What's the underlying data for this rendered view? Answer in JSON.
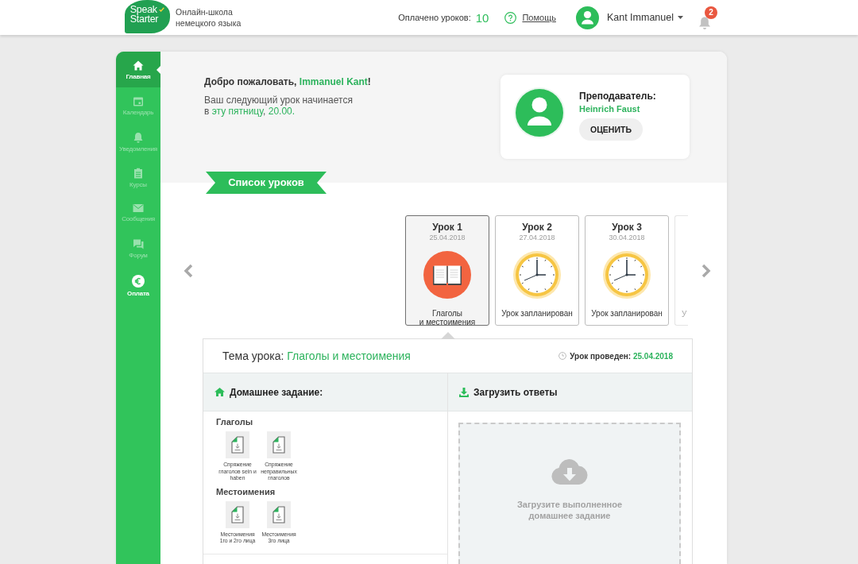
{
  "header": {
    "logo": "Speak Starter",
    "tagline": "Онлайн-школа\nнемецкого языка",
    "paid_label": "Оплачено уроков:",
    "paid_count": "10",
    "help": "Помощь",
    "user": "Kant Immanuel",
    "notifications": "2"
  },
  "sidebar": {
    "items": [
      {
        "label": "Главная",
        "selected": true,
        "disabled": false
      },
      {
        "label": "Календарь",
        "selected": false,
        "disabled": true
      },
      {
        "label": "Уведомления",
        "selected": false,
        "disabled": true
      },
      {
        "label": "Курсы",
        "selected": false,
        "disabled": true
      },
      {
        "label": "Сообщения",
        "selected": false,
        "disabled": true
      },
      {
        "label": "Форум",
        "selected": false,
        "disabled": true
      },
      {
        "label": "Оплата",
        "selected": false,
        "disabled": false
      }
    ]
  },
  "welcome": {
    "segments": [
      {
        "text": "Добро пожаловать, ",
        "kind": "plain"
      },
      {
        "text": "Immanuel Kant",
        "kind": "accent"
      },
      {
        "text": "!",
        "kind": "plain"
      }
    ]
  },
  "next_lesson": {
    "segments": [
      {
        "text": "Ваш следующий урок начинается\nв ",
        "kind": "plain"
      },
      {
        "text": "эту пятницу",
        "kind": "accent"
      },
      {
        "text": ", ",
        "kind": "plain"
      },
      {
        "text": "20.00.",
        "kind": "accent"
      }
    ]
  },
  "teacher": {
    "label": "Преподаватель:",
    "name": "Heinrich Faust",
    "rate_button": "ОЦЕНИТЬ"
  },
  "lessons": {
    "title": "Список уроков",
    "items": [
      {
        "title": "Урок 1",
        "date": "25.04.2018",
        "kind": "completed",
        "caption": "Глаголы\nи местоимения",
        "selected": true
      },
      {
        "title": "Урок 2",
        "date": "27.04.2018",
        "kind": "scheduled",
        "caption": "Урок запланирован",
        "selected": false
      },
      {
        "title": "Урок 3",
        "date": "30.04.2018",
        "kind": "scheduled",
        "caption": "Урок запланирован",
        "selected": false
      }
    ],
    "peek_caption": "У"
  },
  "lesson_details": {
    "topic_label": "Тема урока:",
    "topic": "Глаголы и местоимения",
    "held_label": "Урок проведен:",
    "held_date": "25.04.2018",
    "homework": {
      "title": "Домашнее задание:",
      "groups": [
        {
          "title": "Глаголы",
          "files": [
            "Спряжение\nглаголов sein и\nhaben",
            "Спряжение\nнеправильных\nглаголов"
          ]
        },
        {
          "title": "Местоимения",
          "files": [
            "Местоимения\n1го и 2го лица",
            "Местоимения\n3го лица"
          ]
        }
      ]
    },
    "upload": {
      "title": "Загрузить ответы",
      "dropzone": "Загрузите выполненное\nдомашнее задание"
    }
  }
}
